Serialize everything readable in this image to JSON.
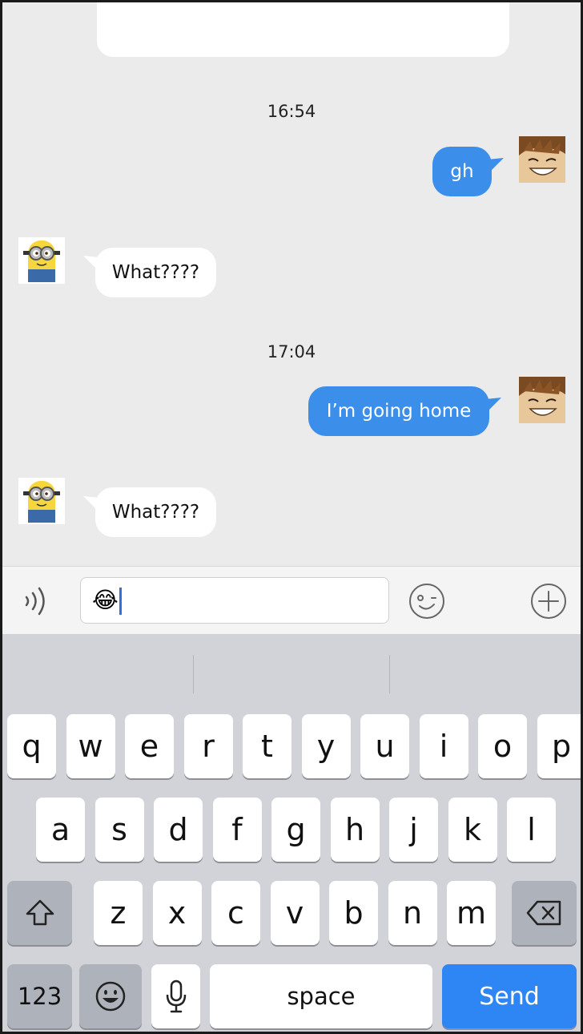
{
  "conversation": {
    "timestamps": [
      "16:54",
      "17:04"
    ],
    "messages": [
      {
        "direction": "out",
        "text": "gh"
      },
      {
        "direction": "in",
        "text": "What????"
      },
      {
        "direction": "out",
        "text": "I’m going home"
      },
      {
        "direction": "in",
        "text": "What????"
      }
    ]
  },
  "input": {
    "value": "😂",
    "icons": {
      "left": "voice-icon",
      "emoji": "emoji-face-icon",
      "add": "add-circle-icon"
    }
  },
  "keyboard": {
    "row1": [
      "q",
      "w",
      "e",
      "r",
      "t",
      "y",
      "u",
      "i",
      "o",
      "p"
    ],
    "row2": [
      "a",
      "s",
      "d",
      "f",
      "g",
      "h",
      "j",
      "k",
      "l"
    ],
    "row3": [
      "z",
      "x",
      "c",
      "v",
      "b",
      "n",
      "m"
    ],
    "numbers_label": "123",
    "space_label": "space",
    "send_label": "Send",
    "icons": {
      "shift": "shift-icon",
      "delete": "backspace-icon",
      "emoji": "emoji-key-icon",
      "mic": "microphone-icon"
    }
  },
  "colors": {
    "outgoing_bubble": "#3b8eea",
    "incoming_bubble": "#ffffff",
    "send_key": "#2d86f3",
    "background": "#ebebeb"
  }
}
